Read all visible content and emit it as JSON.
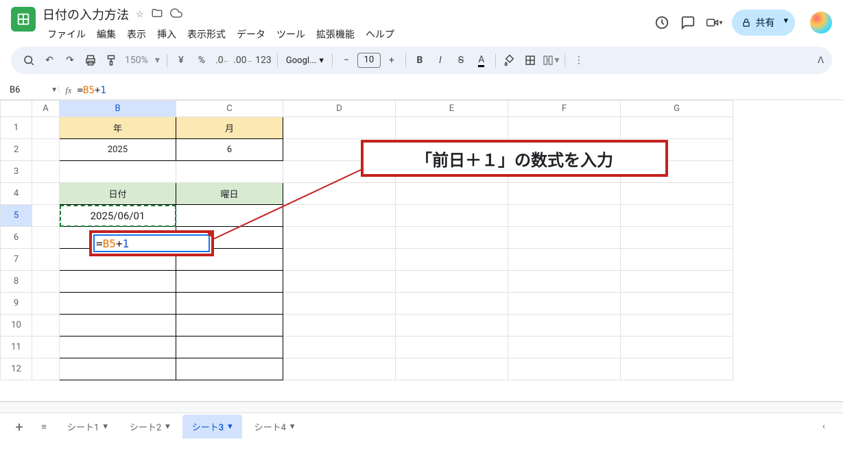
{
  "doc_title": "日付の入力方法",
  "menus": [
    "ファイル",
    "編集",
    "表示",
    "挿入",
    "表示形式",
    "データ",
    "ツール",
    "拡張機能",
    "ヘルプ"
  ],
  "share_label": "共有",
  "toolbar": {
    "zoom": "150%",
    "font": "Googl...",
    "size": "10"
  },
  "name_box": "B6",
  "formula": {
    "eq": "=",
    "ref": "B5",
    "op": "+",
    "num": "1"
  },
  "columns": [
    "A",
    "B",
    "C",
    "D",
    "E",
    "F",
    "G"
  ],
  "rows": [
    "1",
    "2",
    "3",
    "4",
    "5",
    "6",
    "7",
    "8",
    "9",
    "10",
    "11",
    "12"
  ],
  "data": {
    "B1": "年",
    "C1": "月",
    "B2": "2025",
    "C2": "6",
    "B4": "日付",
    "C4": "曜日",
    "B5": "2025/06/01"
  },
  "edit_value": {
    "eq": "=",
    "ref": "B5",
    "op": "+",
    "num": "1"
  },
  "callout_text": "「前日＋１」の数式を入力",
  "sheets": [
    {
      "name": "シート1",
      "active": false
    },
    {
      "name": "シート2",
      "active": false
    },
    {
      "name": "シート3",
      "active": true
    },
    {
      "name": "シート4",
      "active": false
    }
  ]
}
